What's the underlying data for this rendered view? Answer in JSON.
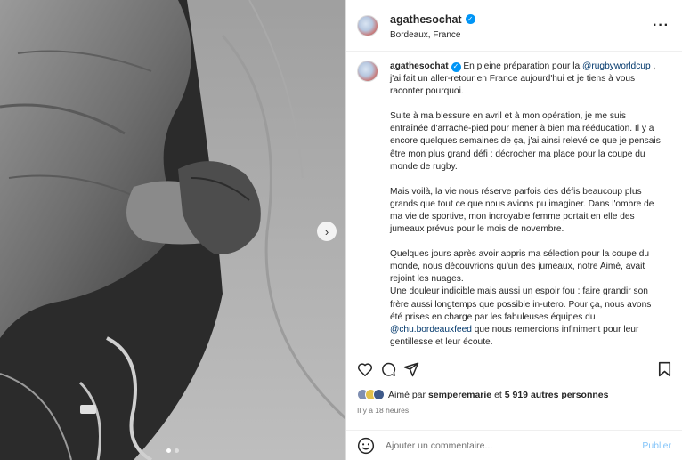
{
  "post": {
    "username": "agathesochat",
    "location": "Bordeaux, France",
    "more_icon": "more-horizontal-icon"
  },
  "photo": {
    "next_icon": "chevron-right-icon",
    "slide_count": 2,
    "active_slide": 1
  },
  "caption": {
    "username": "agathesochat",
    "p1_prefix": "En pleine préparation pour la ",
    "p1_mention": "@rugbyworldcup",
    "p1_suffix": " , j'ai fait un aller-retour en France aujourd'hui et je tiens à vous raconter pourquoi.",
    "p2": "Suite à ma blessure en avril et à mon opération, je me suis entraînée d'arrache-pied pour mener à bien ma rééducation. Il y a encore quelques semaines de ça, j'ai ainsi relevé ce que je pensais être mon plus grand défi : décrocher ma place pour la coupe du monde de rugby.",
    "p3": "Mais voilà, la vie nous réserve parfois des défis beaucoup plus grands que tout ce que nous avions pu imaginer. Dans l'ombre de ma vie de sportive, mon incroyable femme portait en elle des jumeaux prévus pour le mois de novembre.",
    "p4a": "Quelques jours après avoir appris ma sélection pour la coupe du monde, nous découvrions qu'un des jumeaux, notre Aimé, avait rejoint les nuages.",
    "p4b_prefix": "Une douleur indicible mais aussi un espoir fou : faire grandir son frère aussi longtemps que possible in-utero. Pour ça, nous avons été prises en charge par les fabuleuses équipes du ",
    "p4b_mention": "@chu.bordeauxfeed",
    "p4b_suffix": " que nous remercions infiniment pour leur gentillesse et leur écoute."
  },
  "actions": {
    "like_icon": "heart-icon",
    "comment_icon": "comment-icon",
    "share_icon": "send-icon",
    "save_icon": "bookmark-icon"
  },
  "likes": {
    "prefix": "Aimé par ",
    "user": "semperemarie",
    "middle": " et ",
    "count": "5 919 autres personnes"
  },
  "time": "Il y a 18 heures",
  "comment_box": {
    "emoji_icon": "emoji-icon",
    "placeholder": "Ajouter un commentaire...",
    "publish_label": "Publier"
  }
}
